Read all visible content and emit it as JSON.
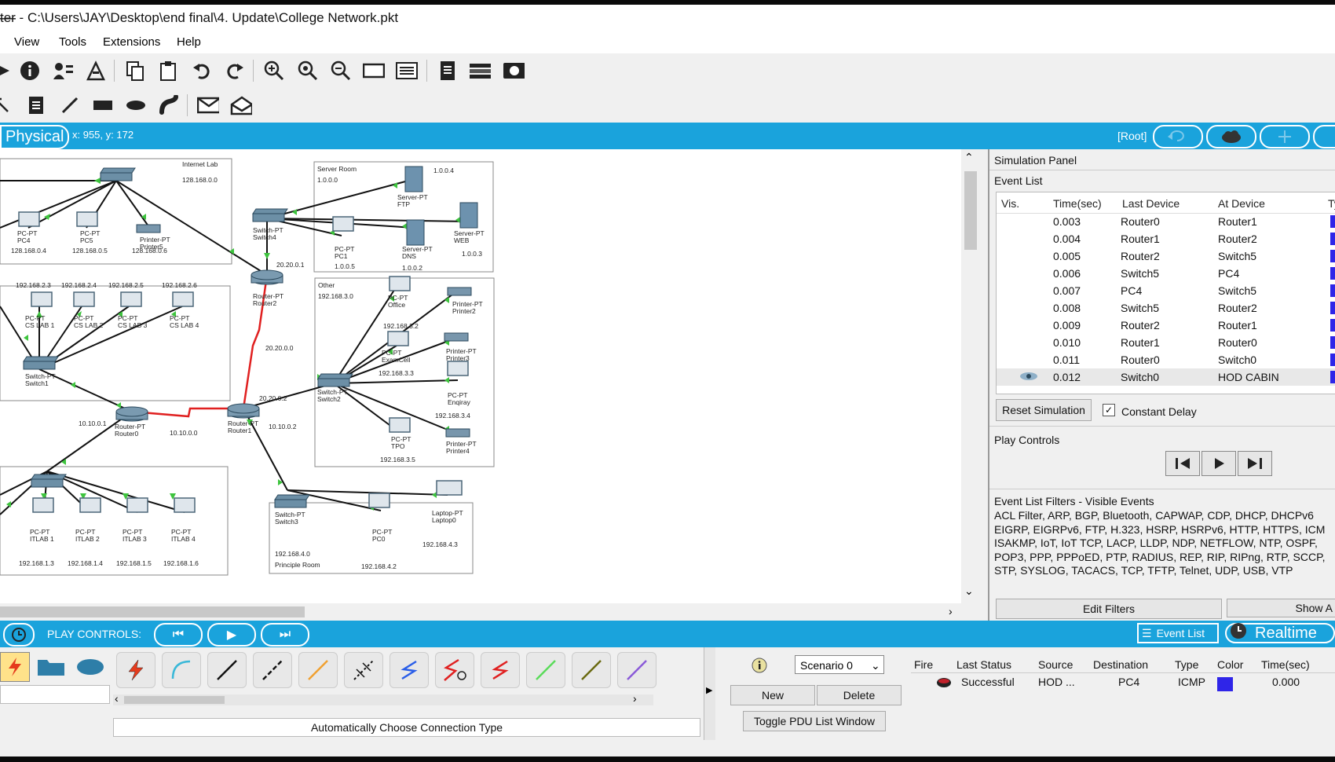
{
  "window": {
    "title": "ter - C:\\Users\\JAY\\Desktop\\end final\\4. Update\\College Network.pkt",
    "minimize": "—"
  },
  "menu": [
    "View",
    "Tools",
    "Extensions",
    "Help"
  ],
  "workspace_bar": {
    "mode": "Physical",
    "coords": "x: 955, y: 172",
    "root": "[Root]"
  },
  "network": {
    "areas": {
      "internet_lab": {
        "title": "Internet Lab",
        "subnet": "128.168.0.0"
      },
      "server_room": {
        "title": "Server Room",
        "subnet": "1.0.0.0",
        "addr4": "1.0.0.4"
      },
      "other": {
        "title": "Other",
        "subnet": "192.168.3.0"
      },
      "principle_room": {
        "title": "Principle Room",
        "subnet": "192.168.4.0"
      }
    },
    "devices": [
      {
        "name": "PC-PT\nPC4",
        "ip": "128.168.0.4"
      },
      {
        "name": "PC-PT\nPC5",
        "ip": "128.168.0.5"
      },
      {
        "name": "Printer-PT\nPrinter5",
        "ip": "128.168.0.6"
      },
      {
        "name": "Server-PT\nFTP"
      },
      {
        "name": "Server-PT\nDNS",
        "ip": "1.0.0.2"
      },
      {
        "name": "Server-PT\nWEB",
        "ip": "1.0.0.3"
      },
      {
        "name": "PC-PT\nPC1",
        "ip": "1.0.0.5"
      },
      {
        "name": "Switch-PT\nSwitch4"
      },
      {
        "name": "Router-PT\nRouter2"
      },
      {
        "name": "PC-PT\nCS LAB 1",
        "ip": "192.168.2.3"
      },
      {
        "name": "PC-PT\nCS LAB 2",
        "ip": "192.168.2.4"
      },
      {
        "name": "PC-PT\nCS LAB 3",
        "ip": "192.168.2.5"
      },
      {
        "name": "PC-PT\nCS LAB 4",
        "ip": "192.168.2.6"
      },
      {
        "name": "Switch-PT\nSwitch1"
      },
      {
        "name": "Router-PT\nRouter0"
      },
      {
        "name": "Router-PT\nRouter1"
      },
      {
        "name": "PC-PT\nOffice",
        "ip": "192.168.3.2"
      },
      {
        "name": "Printer-PT\nPrinter2"
      },
      {
        "name": "Printer-PT\nPrinter3"
      },
      {
        "name": "PC-PT\nExamCell",
        "ip": "192.168.3.3"
      },
      {
        "name": "PC-PT\nEnqiray",
        "ip": "192.168.3.4"
      },
      {
        "name": "PC-PT\nTPO",
        "ip": "192.168.3.5"
      },
      {
        "name": "Printer-PT\nPrinter4"
      },
      {
        "name": "Switch-PT\nSwitch2"
      },
      {
        "name": "Switch-PT\nSwitch3"
      },
      {
        "name": "Laptop-PT\nLaptop0",
        "ip": "192.168.4.3"
      },
      {
        "name": "PC-PT\nPC0",
        "ip": "192.168.4.2"
      },
      {
        "name": "PC-PT\nITLAB 1",
        "ip": "192.168.1.3"
      },
      {
        "name": "PC-PT\nITLAB 2",
        "ip": "192.168.1.4"
      },
      {
        "name": "PC-PT\nITLAB 3",
        "ip": "192.168.1.5"
      },
      {
        "name": "PC-PT\nITLAB 4",
        "ip": "192.168.1.6"
      }
    ],
    "links": [
      "20.20.0.1",
      "20.20.0.0",
      "20.20.0.2",
      "10.10.0.1",
      "10.10.0.0",
      "10.10.0.2"
    ]
  },
  "simulation_panel": {
    "title": "Simulation Panel",
    "event_list_label": "Event List",
    "columns": [
      "Vis.",
      "Time(sec)",
      "Last Device",
      "At Device",
      "Ty"
    ],
    "events": [
      {
        "time": "0.003",
        "last": "Router0",
        "at": "Router1"
      },
      {
        "time": "0.004",
        "last": "Router1",
        "at": "Router2"
      },
      {
        "time": "0.005",
        "last": "Router2",
        "at": "Switch5"
      },
      {
        "time": "0.006",
        "last": "Switch5",
        "at": "PC4"
      },
      {
        "time": "0.007",
        "last": "PC4",
        "at": "Switch5"
      },
      {
        "time": "0.008",
        "last": "Switch5",
        "at": "Router2"
      },
      {
        "time": "0.009",
        "last": "Router2",
        "at": "Router1"
      },
      {
        "time": "0.010",
        "last": "Router1",
        "at": "Router0"
      },
      {
        "time": "0.011",
        "last": "Router0",
        "at": "Switch0"
      },
      {
        "time": "0.012",
        "last": "Switch0",
        "at": "HOD CABIN"
      }
    ],
    "event_color": "#2f25e8",
    "reset_label": "Reset Simulation",
    "constant_delay_label": "Constant Delay",
    "play_controls_label": "Play Controls",
    "filters_title": "Event List Filters - Visible Events",
    "filters_lines": [
      "ACL Filter, ARP, BGP, Bluetooth, CAPWAP, CDP, DHCP, DHCPv6",
      "EIGRP, EIGRPv6, FTP, H.323, HSRP, HSRPv6, HTTP, HTTPS, ICM",
      "ISAKMP, IoT, IoT TCP, LACP, LLDP, NDP, NETFLOW, NTP, OSPF,",
      "POP3, PPP, PPPoED, PTP, RADIUS, REP, RIP, RIPng, RTP, SCCP,",
      "STP, SYSLOG, TACACS, TCP, TFTP, Telnet, UDP, USB, VTP"
    ],
    "edit_filters": "Edit Filters",
    "show_all": "Show A"
  },
  "bottom_bar": {
    "play_controls": "PLAY CONTROLS:",
    "event_list": "Event List",
    "realtime": "Realtime"
  },
  "bottom": {
    "scenario": "Scenario 0",
    "new": "New",
    "delete": "Delete",
    "toggle_pdu": "Toggle PDU List Window",
    "auto_connection": "Automatically Choose Connection Type",
    "pdu_columns": [
      "Fire",
      "Last Status",
      "Source",
      "Destination",
      "Type",
      "Color",
      "Time(sec)"
    ],
    "pdu_row": {
      "status": "Successful",
      "source": "HOD ...",
      "destination": "PC4",
      "type": "ICMP",
      "time": "0.000"
    },
    "pdu_color": "#2f25e8"
  }
}
